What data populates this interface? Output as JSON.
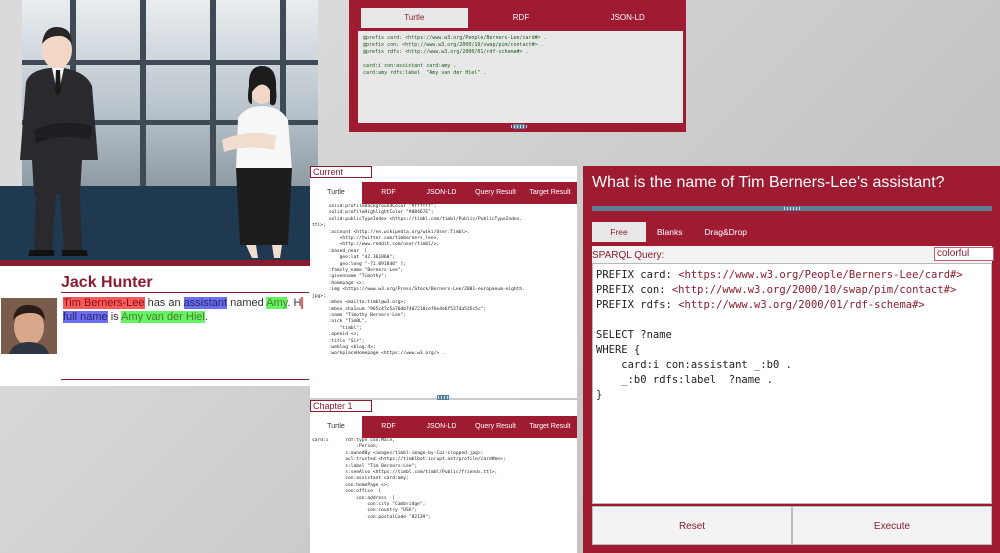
{
  "scene": {
    "person_left": "businessman",
    "person_right": "businesswoman"
  },
  "jack": {
    "name": "Jack Hunter",
    "seg1": "Tim Berners-Lee",
    "seg2": " has an ",
    "seg3": "assistant",
    "seg4": " named ",
    "seg5": "Amy",
    "seg6": ". H",
    "seg7": "full name",
    "seg8": " is ",
    "seg9": "Amy van der Hiel",
    "seg10": "."
  },
  "top_panel": {
    "tabs": [
      "Turtle",
      "RDF",
      "JSON-LD"
    ],
    "code_lines": [
      "@prefix card: <https://www.w3.org/People/Berners-Lee/card#> .",
      "@prefix con: <http://www.w3.org/2000/10/swap/pim/contact#> .",
      "@prefix rdfs: <http://www.w3.org/2000/01/rdf-schema#> .",
      "",
      "card:i con:assistant card:amy .",
      "card:amy rdfs:label  \"Amy van der Hiel\" ."
    ]
  },
  "current": {
    "label": "Current",
    "tabs": [
      "Turtle",
      "RDF",
      "JSON-LD",
      "Query Result",
      "Target Result"
    ],
    "code_lines": [
      "      solid:profileBackgroundColor \"#ffffff\";",
      "      solid:profileHighlightColor \"#00467E\";",
      "      solid:publicTypeIndex <https://timbl.com/timbl/Public/PublicTypeIndex.",
      "ttl>;",
      "      :account <http://en.wikipedia.org/wiki/User:Timbl>,",
      "          <http://twitter.com/timberners_lee>,",
      "          <http://www.reddit.com/user/timbl/>;",
      "      :based_near  [",
      "          geo:lat \"42.361860\";",
      "          geo:long \"-71.091840\" ];",
      "      :family_name \"Berners-Lee\";",
      "      :givenname \"Timothy\";",
      "      :homepage <>;",
      "      :img <https://www.w3.org/Press/Stock/Berners-Lee/2001-europaeum-eighth.",
      "jpg>;",
      "      :mbox <mailto:timbl@w3.org>;",
      "      :mbox_sha1sum \"965c47c5a70db7407210cef6e4e6f5374a525c5c\";",
      "      :name \"Timothy Berners-Lee\";",
      "      :nick \"TimBL\",",
      "          \"timbl\";",
      "      :openid <>;",
      "      :title \"Sir\";",
      "      :weblog <blog:4>;",
      "      :workplaceHomepage <https://www.w3.org/> ."
    ]
  },
  "chapter": {
    "label": "Chapter 1",
    "tabs": [
      "Turtle",
      "RDF",
      "JSON-LD",
      "Query Result",
      "Target Result"
    ],
    "code_lines": [
      "card:i      rdf:type con:Male,",
      "                :Person;",
      "            s:ownedBy <images/timbl-image-by-Coz-cropped.jpg>;",
      "            acl:trusted <https://timblbot.inrupt.net/profile/card#me>;",
      "            s:label \"Tim Berners-Lee\";",
      "            s:seeAlso <https://timbl.com/timbl/Public/friends.ttl>;",
      "            con:assistant card:amy;",
      "            con:homePage <>;",
      "            con:office  [",
      "                con:address  [",
      "                    con:city \"Cambridge\";",
      "                    con:country \"USA\";",
      "                    con:postalCode \"02139\";"
    ]
  },
  "question": {
    "title": "What is the name of Tim Berners-Lee's assistant?",
    "tabs": [
      "Free",
      "Blanks",
      "Drag&Drop"
    ],
    "sparql_label": "SPARQL Query:",
    "style_option": "colorful",
    "query_lines": [
      "PREFIX card: <https://www.w3.org/People/Berners-Lee/card#>",
      "PREFIX con: <http://www.w3.org/2000/10/swap/pim/contact#>",
      "PREFIX rdfs: <http://www.w3.org/2000/01/rdf-schema#>",
      "",
      "SELECT ?name",
      "WHERE {",
      "    card:i con:assistant _:b0 .",
      "    _:b0 rdfs:label  ?name .",
      "}"
    ],
    "reset_label": "Reset",
    "execute_label": "Execute"
  }
}
